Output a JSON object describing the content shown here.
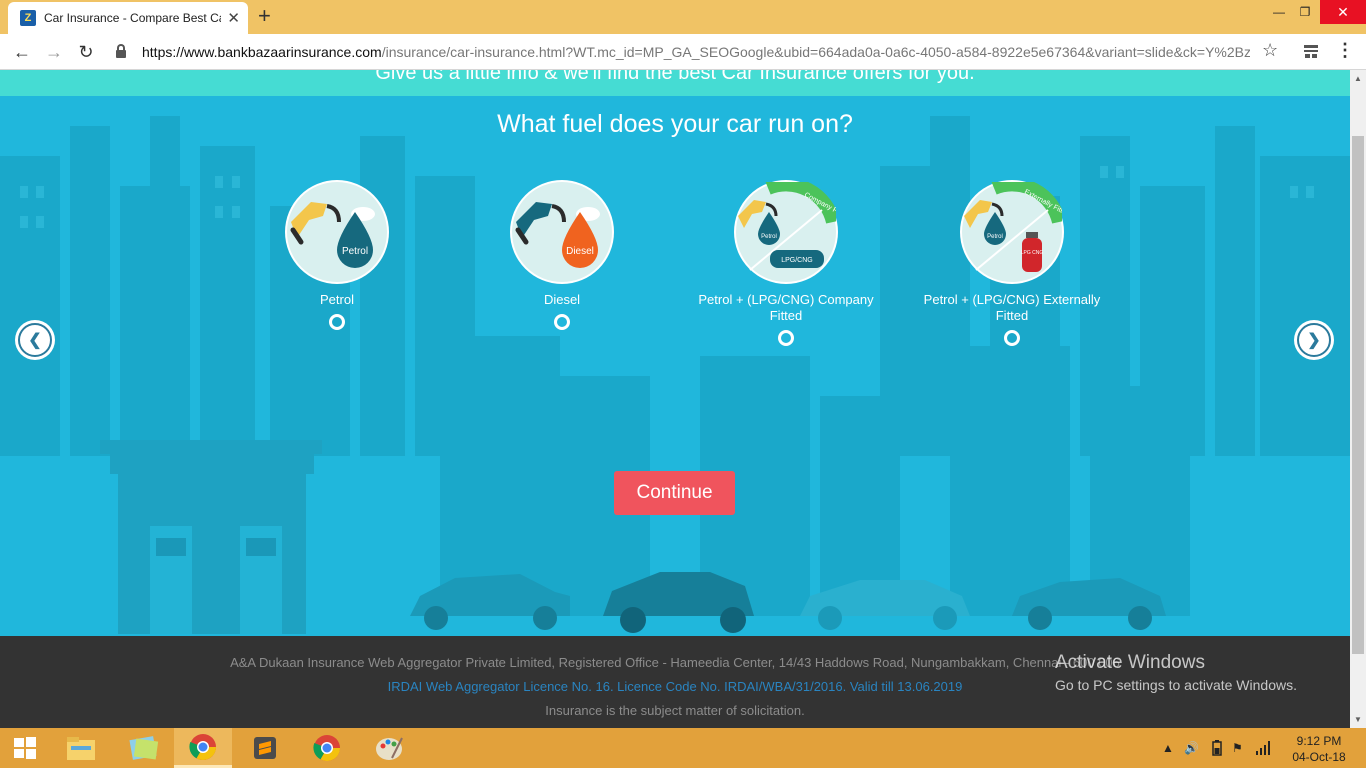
{
  "browser": {
    "tab_title": "Car Insurance - Compare Best Ca",
    "url_host": "https://www.bankbazaarinsurance.com",
    "url_path": "/insurance/car-insurance.html?WT.mc_id=MP_GA_SEOGoogle&ubid=664ada0a-0a6c-4050-a584-8922e5e67364&variant=slide&ck=Y%2Bz...",
    "icons": [
      "back-icon",
      "forward-icon",
      "reload-icon",
      "lock-icon",
      "star-icon",
      "menu-icon"
    ]
  },
  "page": {
    "banner": "Give us a little info & we'll find the best Car Insurance offers for you.",
    "question": "What fuel does your car run on?",
    "options": [
      {
        "label": "Petrol",
        "icon": "petrol-pump-icon",
        "badge": "Petrol"
      },
      {
        "label": "Diesel",
        "icon": "diesel-pump-icon",
        "badge": "Diesel"
      },
      {
        "label": "Petrol + (LPG/CNG) Company Fitted",
        "icon": "company-fitted-icon",
        "badge": "LPG/CNG",
        "ribbon": "Company Fitted",
        "drop": "Petrol"
      },
      {
        "label": "Petrol + (LPG/CNG) Externally Fitted",
        "icon": "externally-fitted-icon",
        "badge": "LPG CNG",
        "ribbon": "Externally Fitted",
        "drop": "Petrol"
      }
    ],
    "continue_label": "Continue",
    "colors": {
      "accent": "#f0545d",
      "background": "#20b7dc",
      "banner": "#45dcd3"
    }
  },
  "footer": {
    "line1": "A&A Dukaan Insurance Web Aggregator Private Limited, Registered Office - Hameedia Center, 14/43 Haddows Road, Nungambakkam, Chennai - 600 006",
    "line2": "IRDAI Web Aggregator Licence No. 16. Licence Code No. IRDAI/WBA/31/2016. Valid till 13.06.2019",
    "line3": "Insurance is the subject matter of solicitation."
  },
  "watermark": {
    "title": "Activate Windows",
    "subtitle": "Go to PC settings to activate Windows."
  },
  "taskbar": {
    "apps": [
      "file-explorer-icon",
      "photo-viewer-icon",
      "chrome-icon",
      "sublime-icon",
      "chrome-icon",
      "paint-icon"
    ],
    "time": "9:12 PM",
    "date": "04-Oct-18"
  }
}
